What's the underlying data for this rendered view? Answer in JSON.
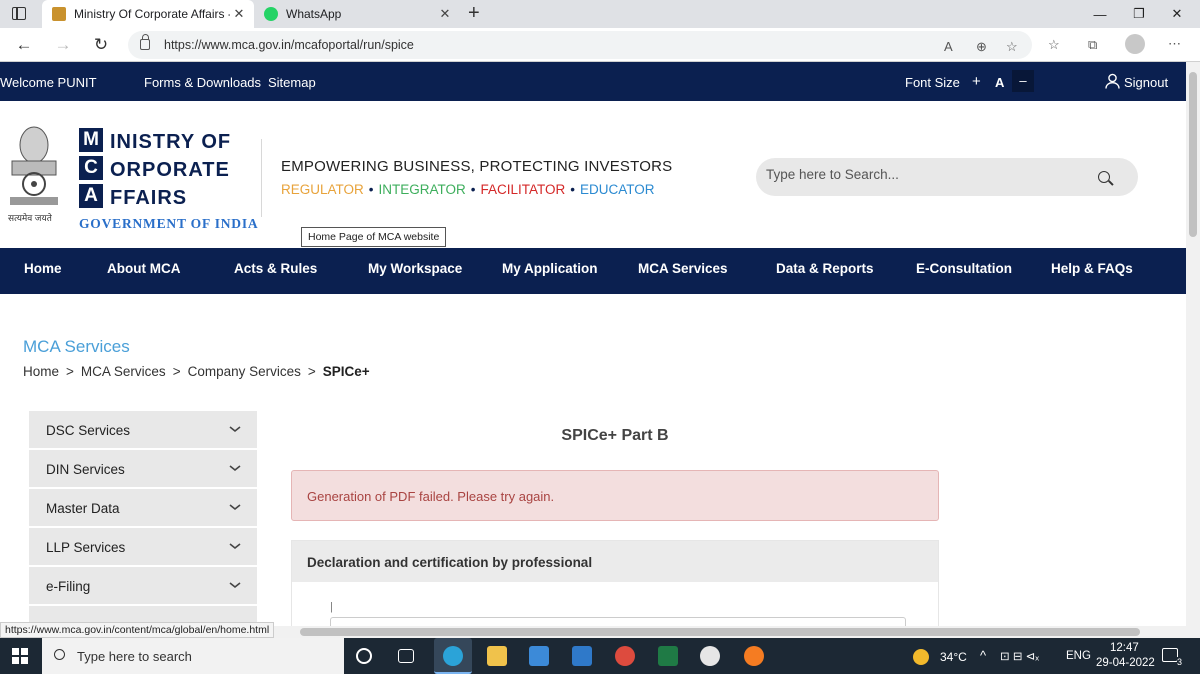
{
  "browser": {
    "tabs": [
      {
        "title": "Ministry Of Corporate Affairs - M"
      },
      {
        "title": "WhatsApp"
      }
    ],
    "url": "https://www.mca.gov.in/mcafoportal/run/spice",
    "status_url": "https://www.mca.gov.in/content/mca/global/en/home.html"
  },
  "topbar": {
    "welcome": "Welcome PUNIT",
    "links": [
      "Forms & Downloads",
      "Sitemap"
    ],
    "font_size_label": "Font Size",
    "font_plus": "+",
    "font_a": "A",
    "font_minus": "–",
    "signout": "Signout"
  },
  "header": {
    "logo_letters": [
      "M",
      "C",
      "A"
    ],
    "logo_words": [
      "INISTRY OF",
      "ORPORATE",
      "FFAIRS"
    ],
    "emblem_caption": "सत्यमेव जयते",
    "government": "GOVERNMENT OF INDIA",
    "tagline": "EMPOWERING BUSINESS, PROTECTING INVESTORS",
    "roles": [
      {
        "label": "REGULATOR",
        "color": "#e8a33b"
      },
      {
        "label": "INTEGRATOR",
        "color": "#3dae5c"
      },
      {
        "label": "FACILITATOR",
        "color": "#d42828"
      },
      {
        "label": "EDUCATOR",
        "color": "#2b8ad1"
      }
    ],
    "search_placeholder": "Type here to Search...",
    "tooltip": "Home Page of MCA website"
  },
  "mainnav": [
    "Home",
    "About MCA",
    "Acts & Rules",
    "My Workspace",
    "My Application",
    "MCA Services",
    "Data & Reports",
    "E-Consultation",
    "Help & FAQs"
  ],
  "content": {
    "section_title": "MCA Services",
    "breadcrumb": [
      "Home",
      "MCA Services",
      "Company Services",
      "SPICe+"
    ],
    "sidebar": [
      "DSC Services",
      "DIN Services",
      "Master Data",
      "LLP Services",
      "e-Filing"
    ],
    "page_heading": "SPICe+ Part B",
    "alert": "Generation of PDF failed. Please try again.",
    "panel_heading": "Declaration and certification by professional"
  },
  "taskbar": {
    "search_placeholder": "Type here to search",
    "temperature": "34°C",
    "language": "ENG",
    "time": "12:47",
    "date": "29-04-2022",
    "notification_count": "3"
  }
}
